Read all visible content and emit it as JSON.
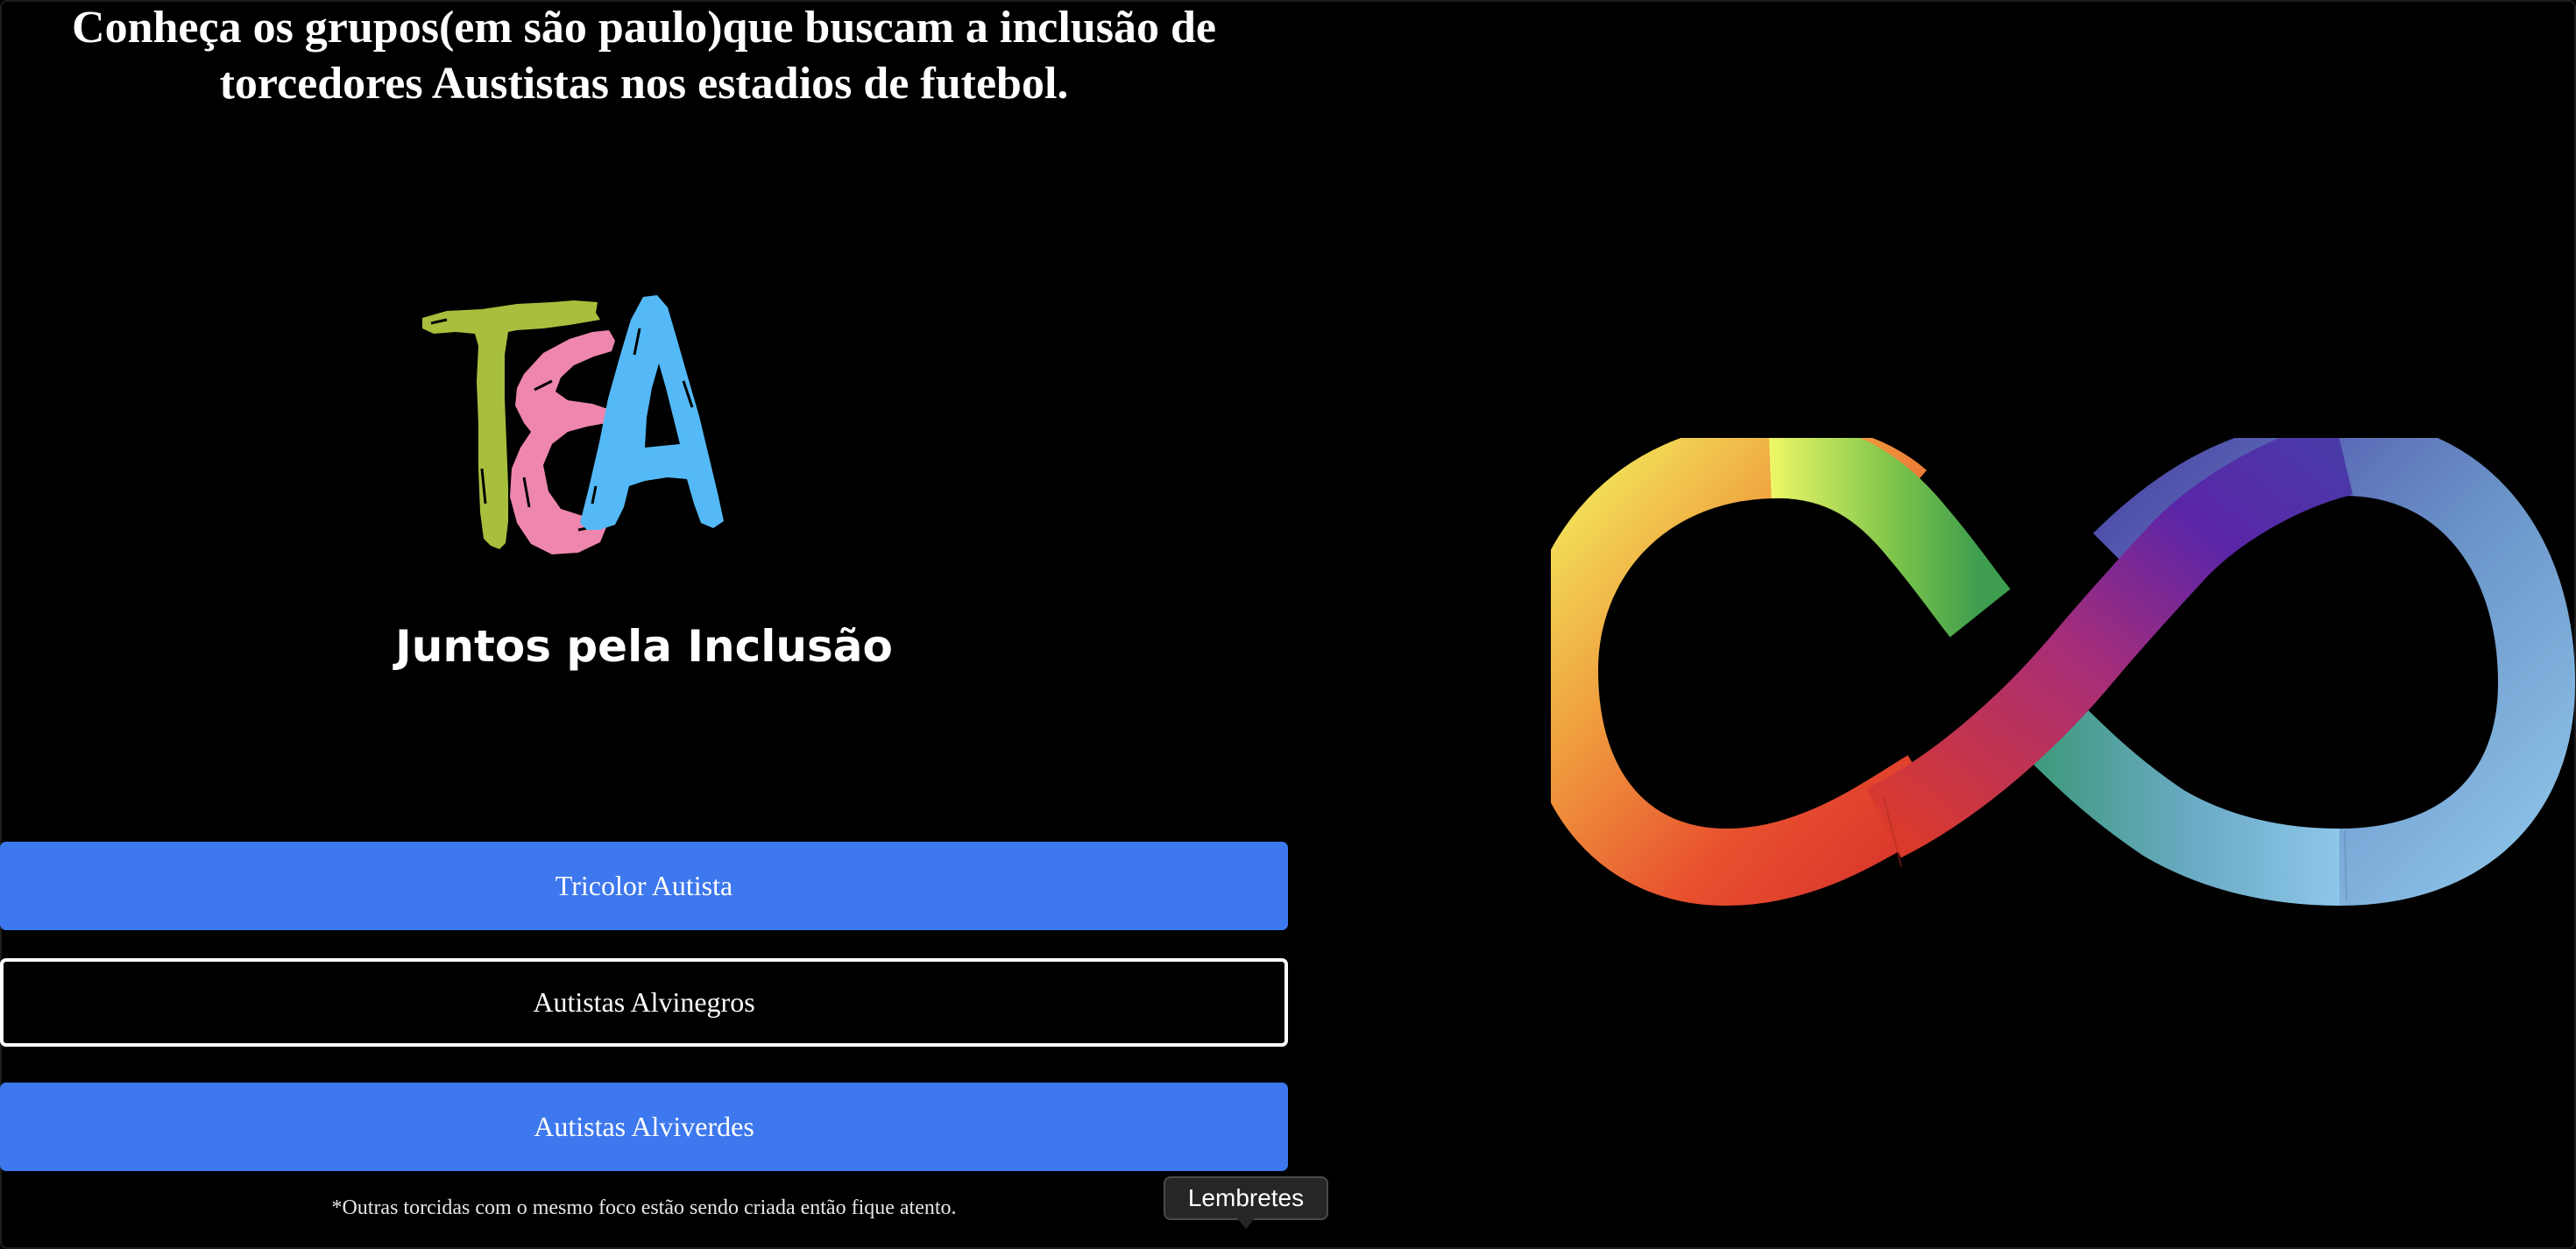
{
  "header": {
    "title": "Conheça os grupos(em são paulo)que buscam a inclusão de torcedores Austistas nos estadios de futebol."
  },
  "logo": {
    "letters": [
      "T",
      "E",
      "A"
    ],
    "colors": [
      "#a7bf3d",
      "#ee86ae",
      "#55b9f7"
    ]
  },
  "tagline": "Juntos pela Inclusão",
  "groups": [
    {
      "label": "Tricolor Autista",
      "style": "filled"
    },
    {
      "label": "Autistas Alvinegros",
      "style": "outlined"
    },
    {
      "label": "Autistas Alviverdes",
      "style": "filled"
    }
  ],
  "footnote": "*Outras torcidas com o mesmo foco estão sendo criada então fique atento.",
  "tooltip": "Lembretes",
  "colors": {
    "background": "#000000",
    "button_blue": "#3d78ee",
    "text": "#ffffff"
  },
  "icons": {
    "illustration": "rainbow-infinity-icon"
  }
}
